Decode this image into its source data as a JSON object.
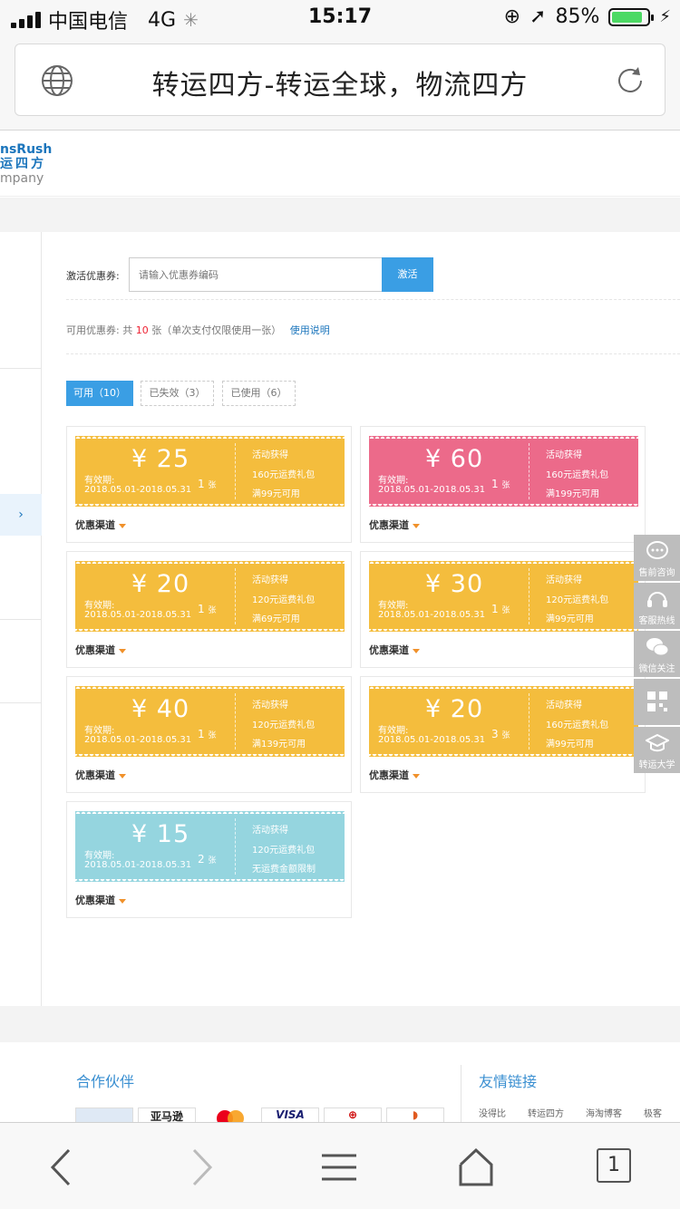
{
  "status_bar": {
    "carrier": "中国电信",
    "network": "4G",
    "time": "15:17",
    "battery": "85%",
    "battery_level": 0.85
  },
  "browser": {
    "page_title": "转运四方-转运全球，物流四方"
  },
  "logo": {
    "line1": "nsRush",
    "line2": "运四方",
    "line3": "mpany"
  },
  "sidebar": {
    "active_chevron": "›"
  },
  "activate": {
    "label": "激活优惠券:",
    "placeholder": "请输入优惠券编码",
    "button": "激活"
  },
  "available": {
    "prefix": "可用优惠券: 共",
    "count": "10",
    "suffix": "张（单次支付仅限使用一张）",
    "link": "使用说明"
  },
  "tabs": [
    {
      "label": "可用（10）",
      "active": true
    },
    {
      "label": "已失效（3）",
      "active": false
    },
    {
      "label": "已使用（6）",
      "active": false
    }
  ],
  "coupons": [
    {
      "amount": "¥ 25",
      "valid_label": "有效期:",
      "valid": "2018.05.01-2018.05.31",
      "count": "1",
      "unit": "张",
      "src": "活动获得",
      "pack": "160元运费礼包",
      "cond": "满99元可用",
      "channel": "优惠渠道",
      "color": "#f4bd3d"
    },
    {
      "amount": "¥ 60",
      "valid_label": "有效期:",
      "valid": "2018.05.01-2018.05.31",
      "count": "1",
      "unit": "张",
      "src": "活动获得",
      "pack": "160元运费礼包",
      "cond": "满199元可用",
      "channel": "优惠渠道",
      "color": "#ec6a8a"
    },
    {
      "amount": "¥ 20",
      "valid_label": "有效期:",
      "valid": "2018.05.01-2018.05.31",
      "count": "1",
      "unit": "张",
      "src": "活动获得",
      "pack": "120元运费礼包",
      "cond": "满69元可用",
      "channel": "优惠渠道",
      "color": "#f4bd3d"
    },
    {
      "amount": "¥ 30",
      "valid_label": "有效期:",
      "valid": "2018.05.01-2018.05.31",
      "count": "1",
      "unit": "张",
      "src": "活动获得",
      "pack": "120元运费礼包",
      "cond": "满99元可用",
      "channel": "优惠渠道",
      "color": "#f4bd3d"
    },
    {
      "amount": "¥ 40",
      "valid_label": "有效期:",
      "valid": "2018.05.01-2018.05.31",
      "count": "1",
      "unit": "张",
      "src": "活动获得",
      "pack": "120元运费礼包",
      "cond": "满139元可用",
      "channel": "优惠渠道",
      "color": "#f4bd3d"
    },
    {
      "amount": "¥ 20",
      "valid_label": "有效期:",
      "valid": "2018.05.01-2018.05.31",
      "count": "3",
      "unit": "张",
      "src": "活动获得",
      "pack": "160元运费礼包",
      "cond": "满99元可用",
      "channel": "优惠渠道",
      "color": "#f4bd3d"
    },
    {
      "amount": "¥ 15",
      "valid_label": "有效期:",
      "valid": "2018.05.01-2018.05.31",
      "count": "2",
      "unit": "张",
      "src": "活动获得",
      "pack": "120元运费礼包",
      "cond": "无运费金额限制",
      "channel": "优惠渠道",
      "color": "#95d5df"
    }
  ],
  "float_toolbar": [
    {
      "label": "售前咨询",
      "icon": "chat-bubble-icon"
    },
    {
      "label": "客服热线",
      "icon": "headset-icon"
    },
    {
      "label": "微信关注",
      "icon": "wechat-icon"
    },
    {
      "label": "",
      "icon": "qr-code-icon"
    },
    {
      "label": "转运大学",
      "icon": "graduation-cap-icon"
    }
  ],
  "footer": {
    "partners_title": "合作伙伴",
    "friends_title": "友情链接",
    "friend_links": [
      "没得比",
      "转运四方",
      "海淘博客",
      "极客"
    ],
    "partner_logos": [
      "",
      "亚马逊",
      "",
      "VISA",
      "",
      ""
    ]
  },
  "bottom_bar": {
    "tab_count": "1"
  }
}
